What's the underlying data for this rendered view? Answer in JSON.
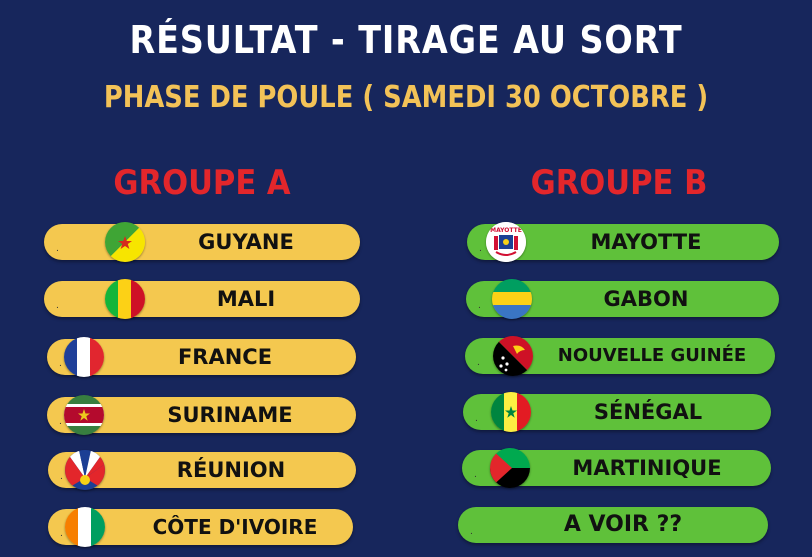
{
  "header": {
    "title": "RÉSULTAT - TIRAGE AU SORT",
    "subtitle": "PHASE DE POULE ( SAMEDI 30 OCTOBRE )"
  },
  "colors": {
    "background": "#17265c",
    "title": "#ffffff",
    "subtitle": "#f3c257",
    "group_title": "#e3262b",
    "group_a_pill": "#f4c84f",
    "group_b_pill": "#5fc13a"
  },
  "group_a": {
    "title": "GROUPE A",
    "teams": [
      {
        "dot": ".",
        "name": "GUYANE",
        "flag": "french-guiana-flag-icon"
      },
      {
        "dot": ".",
        "name": "MALI",
        "flag": "mali-flag-icon"
      },
      {
        "dot": ".",
        "name": "FRANCE",
        "flag": "france-flag-icon"
      },
      {
        "dot": ".",
        "name": "SURINAME",
        "flag": "suriname-flag-icon"
      },
      {
        "dot": ".",
        "name": "RÉUNION",
        "flag": "reunion-flag-icon"
      },
      {
        "dot": ".",
        "name": "CÔTE D'IVOIRE",
        "flag": "ivory-coast-flag-icon"
      }
    ]
  },
  "group_b": {
    "title": "GROUPE B",
    "teams": [
      {
        "dot": ".",
        "name": "MAYOTTE",
        "flag": "mayotte-flag-icon",
        "flag_text": "MAYOTTE"
      },
      {
        "dot": ".",
        "name": "GABON",
        "flag": "gabon-flag-icon"
      },
      {
        "dot": ".",
        "name": "NOUVELLE GUINÉE",
        "flag": "papua-new-guinea-flag-icon"
      },
      {
        "dot": ".",
        "name": "SÉNÉGAL",
        "flag": "senegal-flag-icon"
      },
      {
        "dot": ".",
        "name": "MARTINIQUE",
        "flag": "martinique-flag-icon"
      },
      {
        "dot": ".",
        "name": "A VOIR ??",
        "flag": ""
      }
    ]
  }
}
